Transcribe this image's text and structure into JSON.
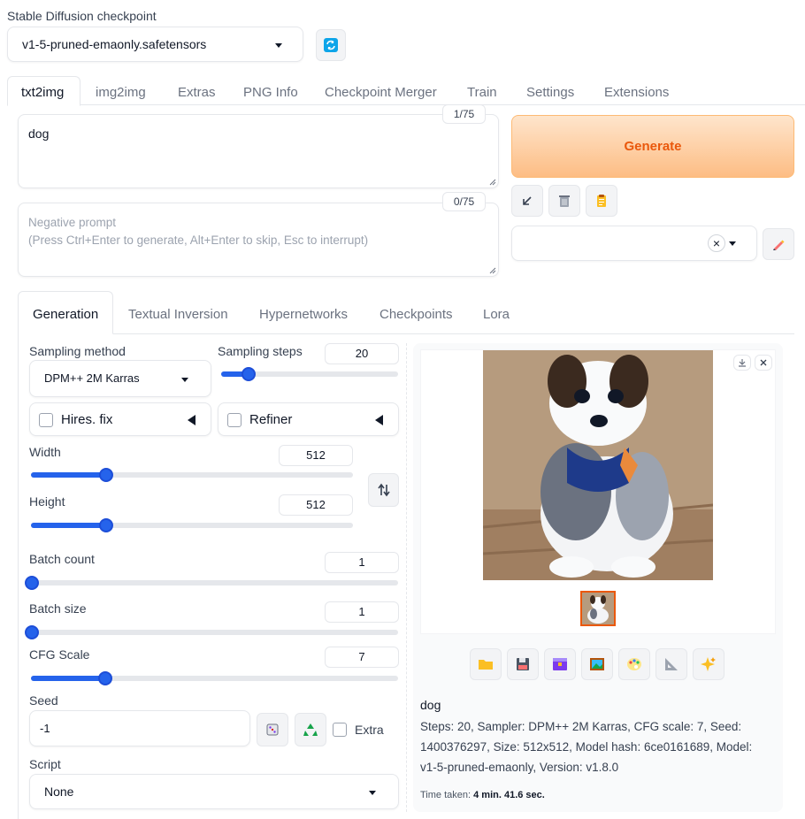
{
  "checkpoint": {
    "label": "Stable Diffusion checkpoint",
    "value": "v1-5-pruned-emaonly.safetensors"
  },
  "tabs": [
    {
      "label": "txt2img",
      "active": true
    },
    {
      "label": "img2img"
    },
    {
      "label": "Extras"
    },
    {
      "label": "PNG Info"
    },
    {
      "label": "Checkpoint Merger"
    },
    {
      "label": "Train"
    },
    {
      "label": "Settings"
    },
    {
      "label": "Extensions"
    }
  ],
  "prompt": {
    "value": "dog",
    "token_count": "1/75"
  },
  "negative_prompt": {
    "placeholder": "Negative prompt\n(Press Ctrl+Enter to generate, Alt+Enter to skip, Esc to interrupt)",
    "token_count": "0/75"
  },
  "generate": {
    "label": "Generate",
    "color": "#ea580c"
  },
  "style_tools": {
    "clear_glyph": "×"
  },
  "subtabs": [
    {
      "label": "Generation",
      "active": true
    },
    {
      "label": "Textual Inversion"
    },
    {
      "label": "Hypernetworks"
    },
    {
      "label": "Checkpoints"
    },
    {
      "label": "Lora"
    }
  ],
  "generation": {
    "sampling_method": {
      "label": "Sampling method",
      "value": "DPM++ 2M Karras"
    },
    "sampling_steps": {
      "label": "Sampling steps",
      "value": "20",
      "fraction": 0.15
    },
    "hires_fix": {
      "label": "Hires. fix"
    },
    "refiner": {
      "label": "Refiner"
    },
    "width": {
      "label": "Width",
      "value": "512",
      "fraction": 0.23
    },
    "height": {
      "label": "Height",
      "value": "512",
      "fraction": 0.23
    },
    "batch_count": {
      "label": "Batch count",
      "value": "1",
      "fraction": 0.0
    },
    "batch_size": {
      "label": "Batch size",
      "value": "1",
      "fraction": 0.0
    },
    "cfg_scale": {
      "label": "CFG Scale",
      "value": "7",
      "fraction": 0.2
    },
    "seed": {
      "label": "Seed",
      "value": "-1",
      "extra_label": "Extra"
    },
    "script": {
      "label": "Script",
      "value": "None"
    }
  },
  "output": {
    "caption_prompt": "dog",
    "info": "Steps: 20, Sampler: DPM++ 2M Karras, CFG scale: 7, Seed: 1400376297, Size: 512x512, Model hash: 6ce0161689, Model: v1-5-pruned-emaonly, Version: v1.8.0",
    "time_label": "Time taken:",
    "time_value": "4 min. 41.6 sec."
  },
  "colors": {
    "accent": "#2563eb",
    "generate_bg_start": "#fed7aa",
    "generate_bg_end": "#fdba74"
  }
}
